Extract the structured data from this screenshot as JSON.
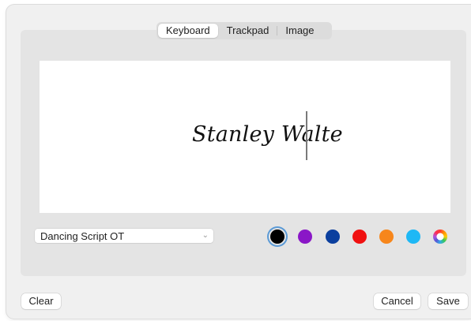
{
  "tabs": [
    {
      "label": "Keyboard"
    },
    {
      "label": "Trackpad"
    },
    {
      "label": "Image"
    }
  ],
  "signature": {
    "text": "Stanley Walte"
  },
  "font_select": {
    "value": "Dancing Script OT",
    "icon": "chevron-down-icon"
  },
  "colors": [
    {
      "name": "black",
      "hex": "#000000",
      "selected": true
    },
    {
      "name": "purple",
      "hex": "#8a17c7"
    },
    {
      "name": "blue",
      "hex": "#0b3f9e"
    },
    {
      "name": "red",
      "hex": "#f01010"
    },
    {
      "name": "orange",
      "hex": "#f7861b"
    },
    {
      "name": "cyan",
      "hex": "#1eb8f5"
    },
    {
      "name": "multicolor",
      "hex": "conic"
    }
  ],
  "buttons": {
    "clear": "Clear",
    "cancel": "Cancel",
    "save": "Save"
  }
}
